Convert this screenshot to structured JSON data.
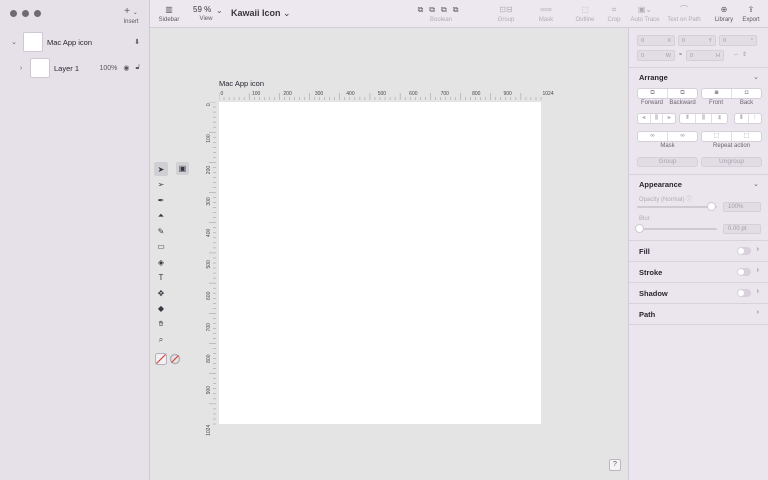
{
  "sidebar": {
    "insert_label": "Insert",
    "layers": [
      {
        "name": "Mac App icon"
      },
      {
        "name": "Layer 1",
        "opacity": "100%"
      }
    ]
  },
  "toolbar": {
    "sidebar_label": "Sidebar",
    "zoom_value": "59 %",
    "view_label": "View",
    "document_title": "Kawaii Icon",
    "boolean_label": "Boolean",
    "group_label": "Group",
    "mask_label": "Mask",
    "outline_label": "Outline",
    "crop_label": "Crop",
    "auto_trace_label": "Auto Trace",
    "text_on_path_label": "Text on Path",
    "library_label": "Library",
    "export_label": "Export"
  },
  "canvas": {
    "artboard_name": "Mac App icon",
    "ruler_top_ticks": [
      "0",
      "100",
      "200",
      "300",
      "400",
      "500",
      "600",
      "700",
      "800",
      "900",
      "1024"
    ],
    "ruler_left_ticks": [
      "0",
      "100",
      "200",
      "300",
      "400",
      "500",
      "600",
      "700",
      "800",
      "900",
      "1024"
    ],
    "help": "?"
  },
  "tools": [
    "select-tool",
    "direct-select-tool",
    "pen-tool",
    "vector-tool",
    "brush-tool",
    "shape-tool",
    "fill-tool",
    "text-tool",
    "crop-move-tool",
    "eraser-tool",
    "hand-tool",
    "zoom-tool"
  ],
  "inspector": {
    "geometry": {
      "x": {
        "value": "0",
        "label": "X"
      },
      "y": {
        "value": "0",
        "label": "Y"
      },
      "rot": {
        "value": "0",
        "label": "°"
      },
      "w": {
        "value": "0",
        "label": "W"
      },
      "h": {
        "value": "0",
        "label": "H"
      }
    },
    "arrange": {
      "title": "Arrange",
      "forward": "Forward",
      "backward": "Backward",
      "front": "Front",
      "back": "Back",
      "mask": "Mask",
      "repeat_action": "Repeat action",
      "group": "Group",
      "ungroup": "Ungroup"
    },
    "appearance": {
      "title": "Appearance",
      "opacity_label": "Opacity (Normal)",
      "opacity_value": "100%",
      "blur_label": "Blur",
      "blur_value": "0.00 pt"
    },
    "fill": "Fill",
    "stroke": "Stroke",
    "shadow": "Shadow",
    "path": "Path"
  }
}
